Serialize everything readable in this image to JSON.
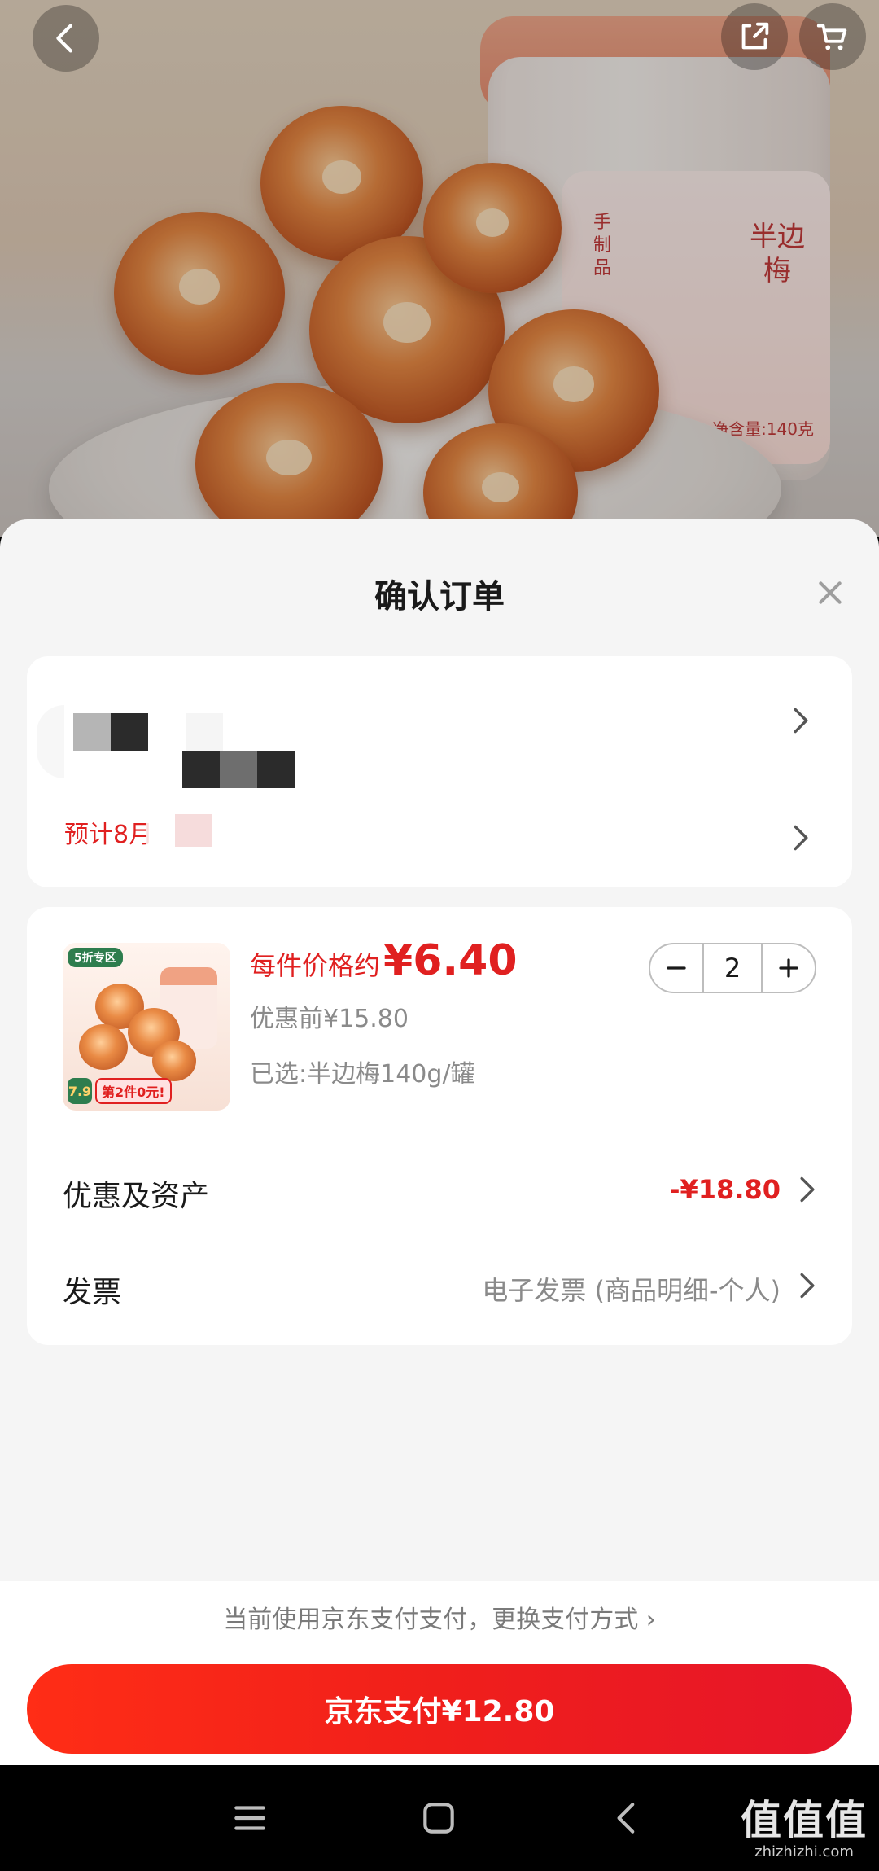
{
  "hero": {
    "jar_label": "半边梅",
    "jar_small": "手制品",
    "jar_weight": "净含量:140克"
  },
  "sheet": {
    "title": "确认订单"
  },
  "address": {
    "eta": "预计8月"
  },
  "product": {
    "thumb_tag": "5折专区",
    "thumb_price": "7.9",
    "thumb_promo": "第2件0元!",
    "price_prefix": "每件价格约",
    "price": "¥6.40",
    "original_price": "优惠前¥15.80",
    "selected_spec": "已选:半边梅140g/罐",
    "quantity": "2"
  },
  "rows": {
    "discount_label": "优惠及资产",
    "discount_value": "-¥18.80",
    "invoice_label": "发票",
    "invoice_value": "电子发票 (商品明细-个人)"
  },
  "payment": {
    "method_text": "当前使用京东支付支付，更换支付方式 ›",
    "button_label": "京东支付¥12.80"
  },
  "watermark": {
    "main": "值值值",
    "sub": "zhizhizhi.com"
  },
  "colors": {
    "accent_red": "#e02020",
    "pay_gradient_start": "#ff2d16",
    "pay_gradient_end": "#e6152a"
  },
  "icons": {
    "back": "back-arrow-icon",
    "share": "share-icon",
    "cart": "cart-icon",
    "close": "close-icon",
    "chevron": "chevron-right-icon",
    "minus": "minus-icon",
    "plus": "plus-icon"
  }
}
